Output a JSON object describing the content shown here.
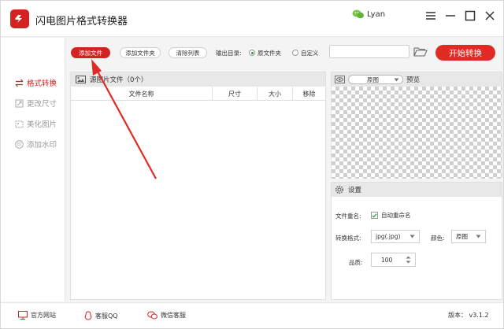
{
  "app": {
    "title": "闪电图片格式转换器",
    "user_name": "Lyan"
  },
  "sidebar": {
    "items": [
      {
        "label": "格式转换",
        "active": true,
        "icon": "swap-icon"
      },
      {
        "label": "更改尺寸",
        "active": false,
        "icon": "resize-icon"
      },
      {
        "label": "美化图片",
        "active": false,
        "icon": "beautify-icon"
      },
      {
        "label": "添加水印",
        "active": false,
        "icon": "watermark-icon"
      }
    ]
  },
  "toolbar": {
    "add_file": "添加文件",
    "add_folder": "添加文件夹",
    "clear_list": "清除列表",
    "output_dir_label": "输出目录:",
    "option_source": "原文件夹",
    "option_custom": "自定义",
    "path_value": "",
    "start": "开始转换"
  },
  "file_panel": {
    "title": "源图片文件（0个）",
    "columns": [
      "文件名称",
      "尺寸",
      "大小",
      "移除"
    ]
  },
  "preview": {
    "mode_value": "原图",
    "label": "预览"
  },
  "settings": {
    "title": "设置",
    "rename_label": "文件重名:",
    "auto_rename": "自动重命名",
    "auto_rename_checked": true,
    "format_label": "转换格式:",
    "format_value": "jpg(.jpg)",
    "color_label": "颜色:",
    "color_value": "原图",
    "quality_label": "品质:",
    "quality_value": "100"
  },
  "status": {
    "website": "官方网站",
    "qq": "客服QQ",
    "wechat": "微信客服",
    "version": "版本： v3.1.2"
  },
  "colors": {
    "accent": "#d32222",
    "check_green": "#2a9d3a"
  }
}
